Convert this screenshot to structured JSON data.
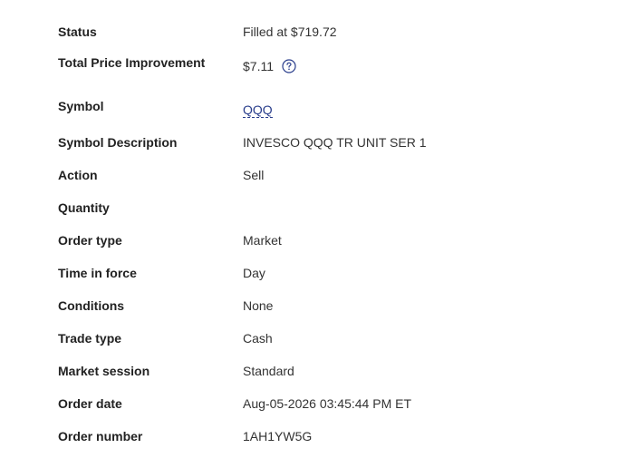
{
  "order_details": {
    "rows": [
      {
        "label": "Status",
        "value": "Filled at $719.72"
      },
      {
        "label": "Total Price Improvement",
        "value": "$7.11"
      },
      {
        "label": "Symbol",
        "value": "QQQ"
      },
      {
        "label": "Symbol Description",
        "value": "INVESCO QQQ TR UNIT SER 1"
      },
      {
        "label": "Action",
        "value": "Sell"
      },
      {
        "label": "Quantity",
        "value": ""
      },
      {
        "label": "Order type",
        "value": "Market"
      },
      {
        "label": "Time in force",
        "value": "Day"
      },
      {
        "label": "Conditions",
        "value": "None"
      },
      {
        "label": "Trade type",
        "value": "Cash"
      },
      {
        "label": "Market session",
        "value": "Standard"
      },
      {
        "label": "Order date",
        "value": "Aug-05-2026 03:45:44 PM ET"
      },
      {
        "label": "Order number",
        "value": "1AH1YW5G"
      }
    ],
    "help_icon": "question-circle-icon",
    "colors": {
      "link": "#2a3e8c",
      "label": "#222222",
      "value": "#333333"
    }
  }
}
